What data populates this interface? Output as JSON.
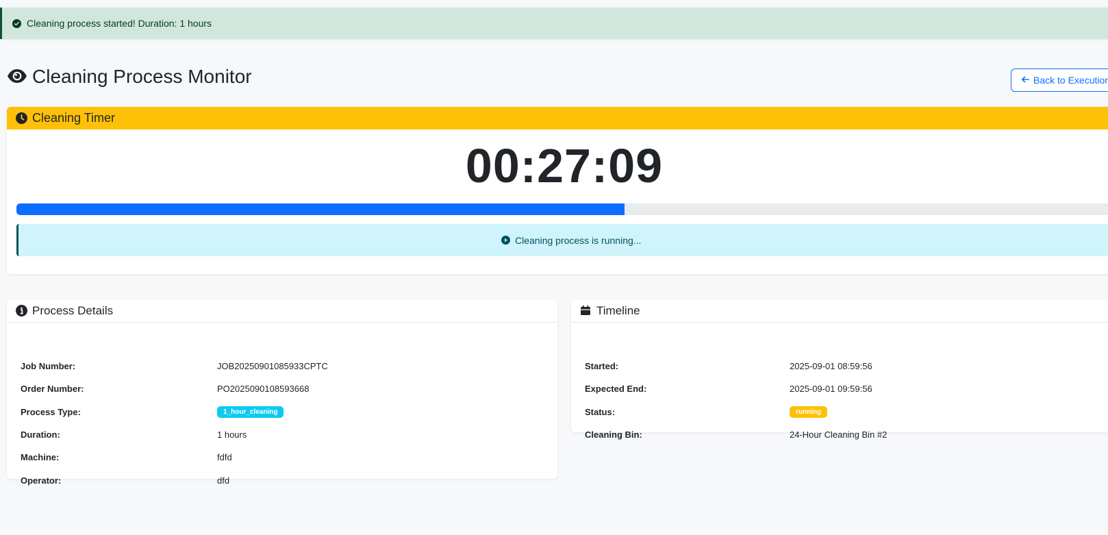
{
  "alert": {
    "message": "Cleaning process started! Duration: 1 hours",
    "icon": "check-circle-icon"
  },
  "header": {
    "title": "Cleaning Process Monitor",
    "icon": "eye-icon",
    "back_label": "Back to Execution"
  },
  "timer": {
    "heading": "Cleaning Timer",
    "value": "00:27:09",
    "progress_fraction": 0.545,
    "status_text": "Cleaning process is running..."
  },
  "details": {
    "heading": "Process Details",
    "rows": [
      {
        "label": "Job Number:",
        "value": "JOB20250901085933CPTC"
      },
      {
        "label": "Order Number:",
        "value": "PO2025090108593668"
      },
      {
        "label": "Process Type:",
        "value": "1_hour_cleaning"
      },
      {
        "label": "Duration:",
        "value": "1 hours"
      },
      {
        "label": "Machine:",
        "value": "fdfd"
      },
      {
        "label": "Operator:",
        "value": "dfd"
      }
    ]
  },
  "timeline": {
    "heading": "Timeline",
    "rows": [
      {
        "label": "Started:",
        "value": "2025-09-01 08:59:56"
      },
      {
        "label": "Expected End:",
        "value": "2025-09-01 09:59:56"
      },
      {
        "label": "Status:",
        "value": "running"
      },
      {
        "label": "Cleaning Bin:",
        "value": "24-Hour Cleaning Bin #2"
      }
    ]
  },
  "colors": {
    "accent": "#0d6efd",
    "warning": "#ffc107",
    "info": "#0dcaf0",
    "success_bg": "#d1e7dd"
  }
}
